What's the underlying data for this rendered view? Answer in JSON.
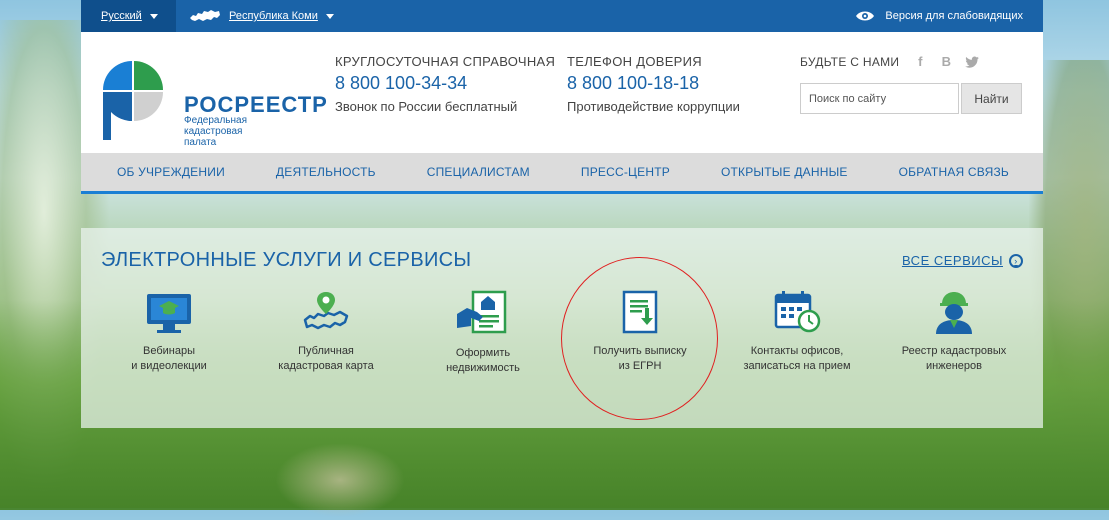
{
  "topbar": {
    "language": "Русский",
    "region": "Республика Коми",
    "vision": "Версия для слабовидящих"
  },
  "logo": {
    "name": "РОСРЕЕСТР",
    "subtitle": [
      "Федеральная",
      "кадастровая",
      "палата"
    ]
  },
  "contacts": [
    {
      "label": "КРУГЛОСУТОЧНАЯ СПРАВОЧНАЯ",
      "number": "8 800 100-34-34",
      "note": "Звонок по России бесплатный"
    },
    {
      "label": "ТЕЛЕФОН ДОВЕРИЯ",
      "number": "8 800 100-18-18",
      "note": "Противодействие коррупции"
    }
  ],
  "social": {
    "label": "БУДЬТЕ С НАМИ",
    "icons": [
      "facebook-icon",
      "vk-icon",
      "twitter-icon"
    ]
  },
  "search": {
    "placeholder": "Поиск по сайту",
    "button": "Найти"
  },
  "nav": [
    "ОБ УЧРЕЖДЕНИИ",
    "ДЕЯТЕЛЬНОСТЬ",
    "СПЕЦИАЛИСТАМ",
    "ПРЕСС-ЦЕНТР",
    "ОТКРЫТЫЕ ДАННЫЕ",
    "ОБРАТНАЯ СВЯЗЬ"
  ],
  "services": {
    "title": "ЭЛЕКТРОННЫЕ УСЛУГИ И СЕРВИСЫ",
    "all_link": "ВСЕ СЕРВИСЫ",
    "items": [
      {
        "icon": "webinar-icon",
        "line1": "Вебинары",
        "line2": "и видеолекции"
      },
      {
        "icon": "map-pin-icon",
        "line1": "Публичная",
        "line2": "кадастровая карта"
      },
      {
        "icon": "property-document-icon",
        "line1": "Оформить",
        "line2": "недвижимость"
      },
      {
        "icon": "egrn-document-icon",
        "line1": "Получить выписку",
        "line2": "из ЕГРН"
      },
      {
        "icon": "calendar-clock-icon",
        "line1": "Контакты офисов,",
        "line2": "записаться на прием"
      },
      {
        "icon": "engineer-icon",
        "line1": "Реестр кадастровых",
        "line2": "инженеров"
      }
    ]
  },
  "colors": {
    "brand": "#1a63a8",
    "topbar": "#1a63a8",
    "accent_green": "#4caf50",
    "annotation": "#e02020"
  }
}
